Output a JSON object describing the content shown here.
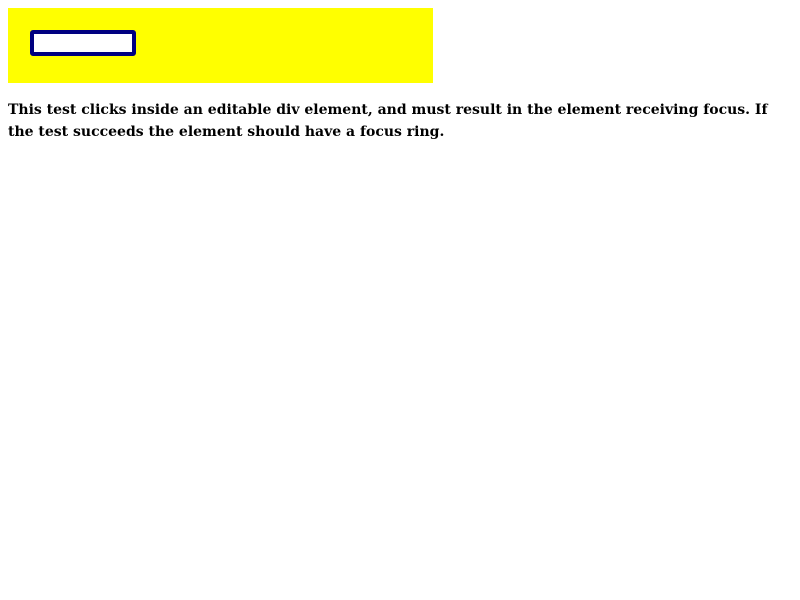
{
  "colors": {
    "container_background": "#ffff00",
    "editable_border": "#000080",
    "editable_background": "#ffffff",
    "text": "#000000"
  },
  "editable_div": {
    "content": ""
  },
  "description": "This test clicks inside an editable div element, and must result in the element receiving focus. If the test succeeds the element should have a focus ring."
}
